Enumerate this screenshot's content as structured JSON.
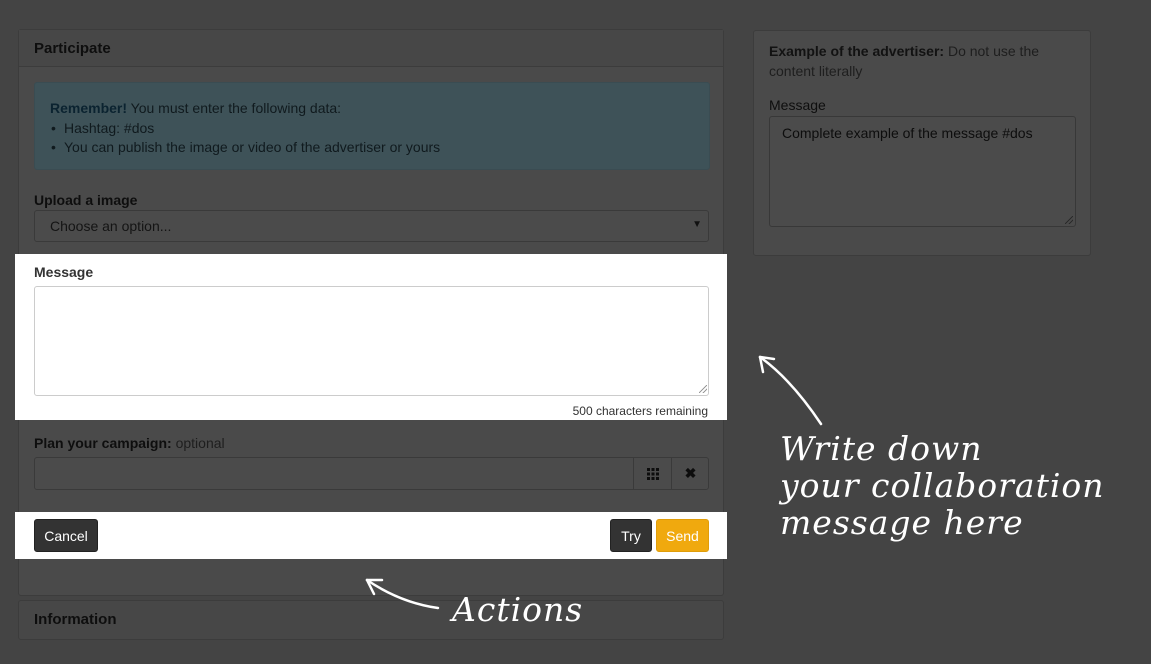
{
  "participate": {
    "title": "Participate",
    "alert": {
      "strong": "Remember!",
      "text": " You must enter the following data:",
      "items": [
        "Hashtag: #dos",
        "You can publish the image or video of the advertiser or yours"
      ]
    },
    "upload": {
      "label": "Upload a image",
      "selected": "Choose an option..."
    },
    "message": {
      "label": "Message",
      "value": "",
      "remaining": "500 characters remaining"
    },
    "plan": {
      "label": "Plan your campaign:",
      "optional": " optional"
    },
    "buttons": {
      "cancel": "Cancel",
      "try": "Try",
      "send": "Send"
    }
  },
  "information": {
    "title": "Information"
  },
  "example": {
    "strong": "Example of the advertiser:",
    "note": " Do not use the content literally",
    "message_label": "Message",
    "message_text": "Complete example of the message #dos"
  },
  "annotations": {
    "message_hint_lines": [
      "Write down",
      "your collaboration",
      "message here"
    ],
    "actions_hint": "Actions"
  },
  "colors": {
    "send": "#f0a90e",
    "dark_button": "#333333",
    "overlay": "#444444"
  },
  "icons": {
    "grid": "grid-icon",
    "close": "close-icon",
    "caret": "caret-down-icon"
  }
}
